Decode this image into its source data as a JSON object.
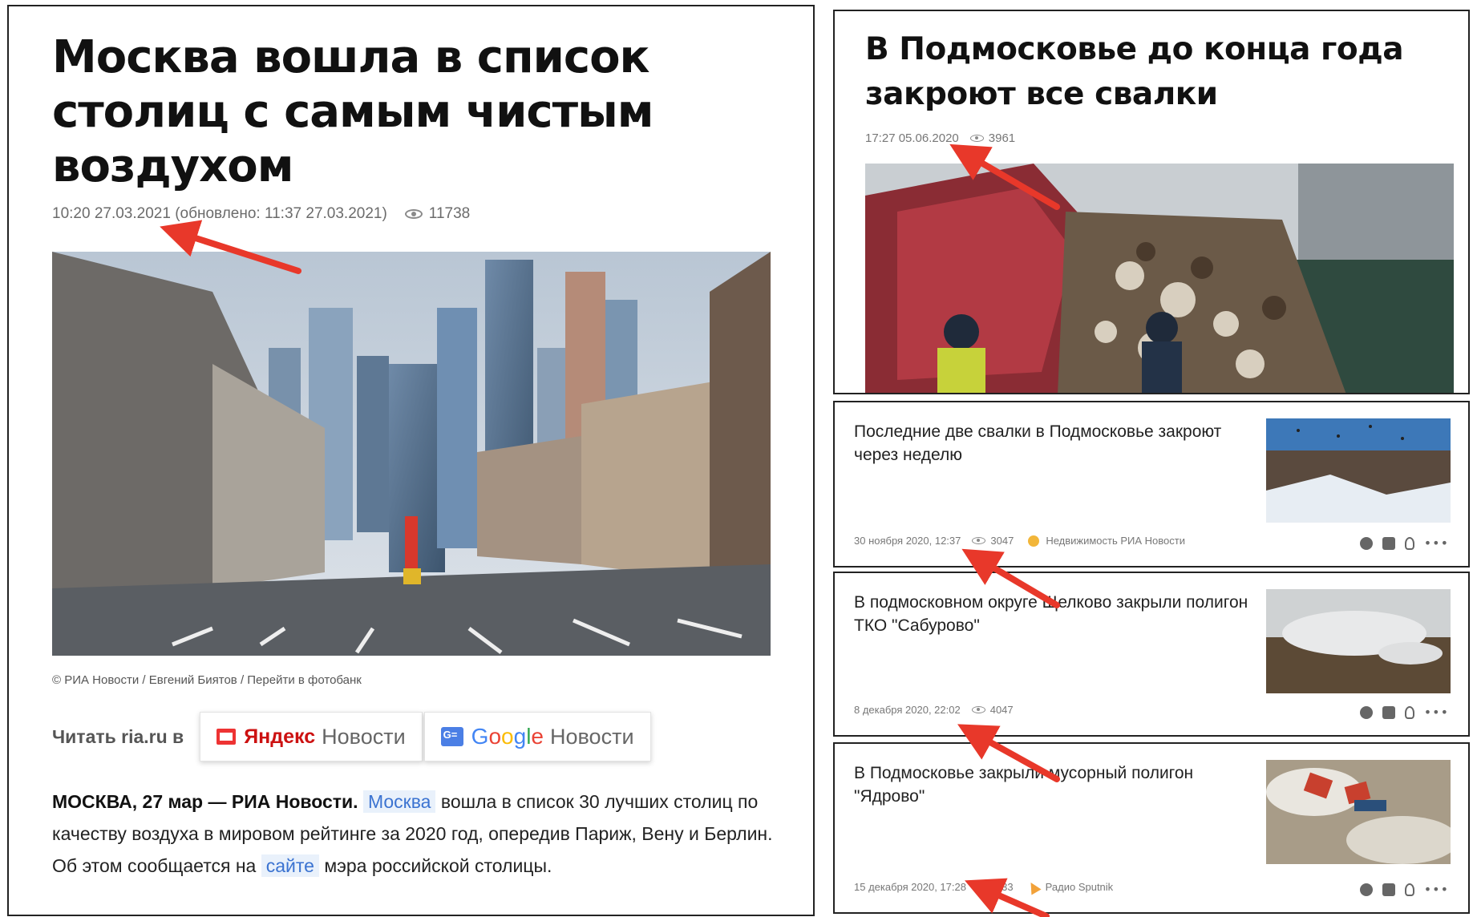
{
  "left_article": {
    "title": "Москва вошла в список столиц с самым чистым воздухом",
    "published": "10:20 27.03.2021 (обновлено: 11:37 27.03.2021)",
    "views": "11738",
    "photo_caption": "© РИА Новости / Евгений Биятов / Перейти в фотобанк",
    "read_label": "Читать ria.ru в",
    "yandex_brand": "Яндекс",
    "yandex_word": "Новости",
    "google_brand_letters": [
      "G",
      "o",
      "o",
      "g",
      "l",
      "e"
    ],
    "google_word": "Новости",
    "lead_bold": "МОСКВА, 27 мар — РИА Новости.",
    "lead_link1": "Москва",
    "lead_text1": " вошла в список 30 лучших столиц по качеству воздуха в мировом рейтинге за 2020 год, опередив Париж, Вену и Берлин. Об этом сообщается на ",
    "lead_link2": "сайте",
    "lead_text2": " мэра российской столицы."
  },
  "right_top": {
    "title": "В Подмосковье до конца года закроют все свалки",
    "published": "17:27 05.06.2020",
    "views": "3961"
  },
  "cards": [
    {
      "title": "Последние две свалки в Подмосковье закроют через неделю",
      "date": "30 ноября 2020, 12:37",
      "views": "3047",
      "source": "Недвижимость РИА Новости"
    },
    {
      "title": "В подмосковном округе Щелково закрыли полигон ТКО \"Сабурово\"",
      "date": "8 декабря 2020, 22:02",
      "views": "4047",
      "source": ""
    },
    {
      "title": "В Подмосковье закрыли мусорный полигон \"Ядрово\"",
      "date": "15 декабря 2020, 17:28",
      "views": "233",
      "source": "Радио Sputnik"
    }
  ],
  "colors": {
    "arrow": "#e8382a",
    "link": "#3b73d1",
    "link_bg": "#e9f1fb",
    "meta": "#6b6b6b"
  },
  "icons": [
    "eye-icon",
    "yandex-news-icon",
    "google-news-icon",
    "facebook-icon",
    "vk-icon",
    "odnoklassniki-icon",
    "more-icon",
    "ria-realty-icon",
    "sputnik-icon"
  ]
}
